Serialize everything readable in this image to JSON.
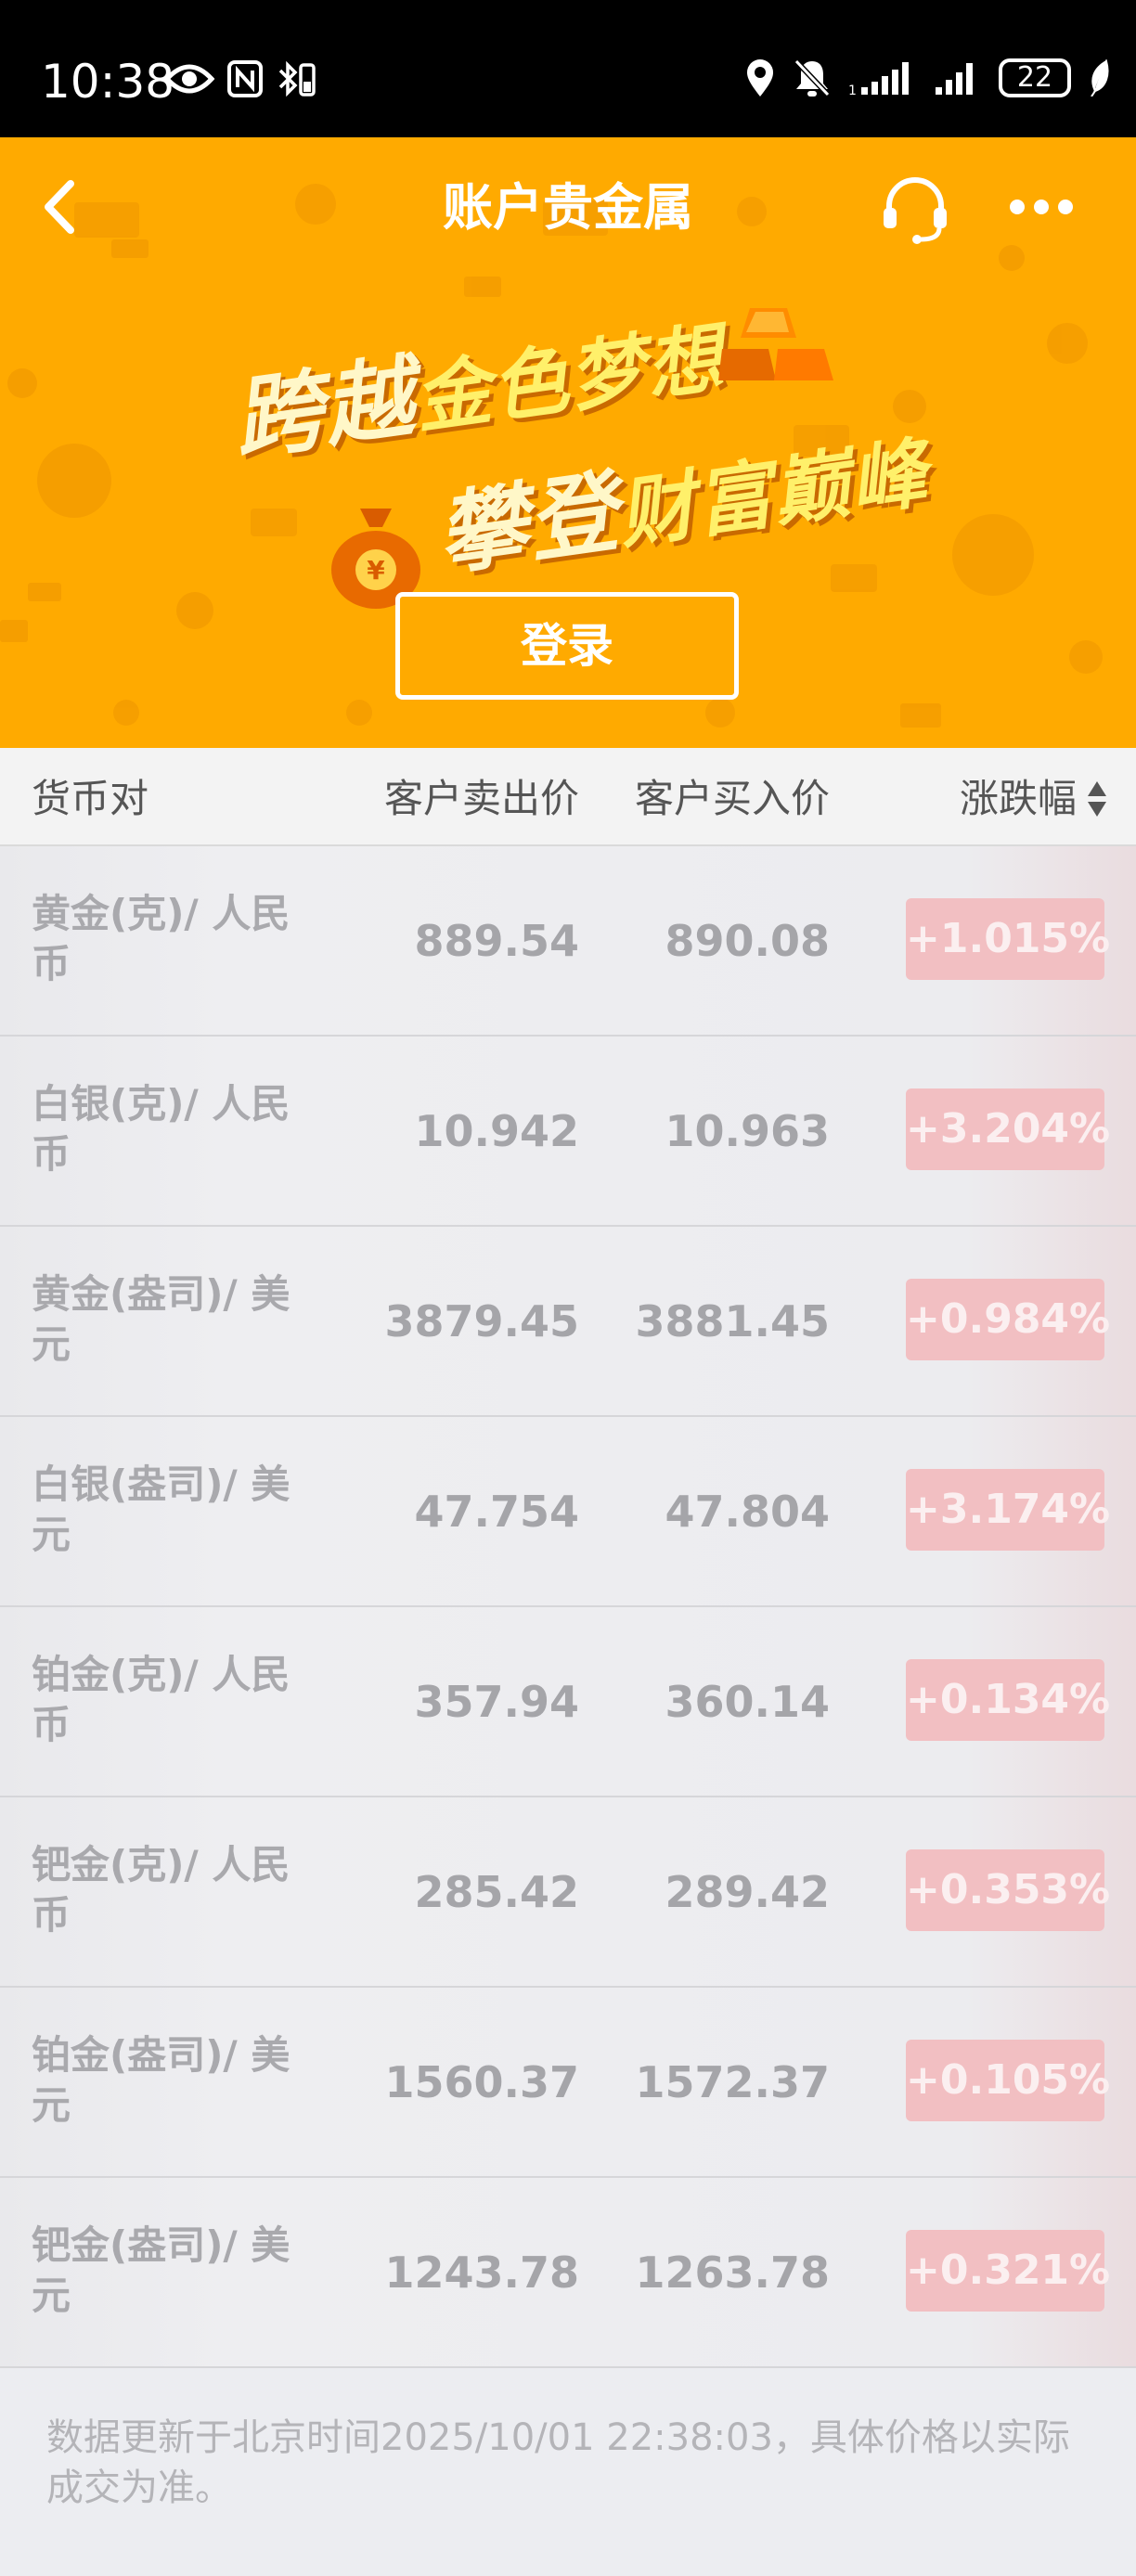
{
  "status_bar": {
    "time": "10:38",
    "battery": "22",
    "icons": [
      "eye-icon",
      "nfc-icon",
      "bluetooth-icon",
      "location-icon",
      "mute-icon",
      "signal-icon",
      "signal-icon",
      "battery-icon",
      "leaf-icon"
    ]
  },
  "header": {
    "title": "账户贵金属",
    "slogan_line1_a": "跨越",
    "slogan_line1_b": "金色梦想",
    "slogan_line2_a": "攀登",
    "slogan_line2_b": "财富巅峰",
    "login_label": "登录"
  },
  "table": {
    "columns": [
      "货币对",
      "客户卖出价",
      "客户买入价",
      "涨跌幅"
    ],
    "rows": [
      {
        "name": "黄金(克)/ 人民币",
        "sell": "889.54",
        "buy": "890.08",
        "change": "+1.015%"
      },
      {
        "name": "白银(克)/ 人民币",
        "sell": "10.942",
        "buy": "10.963",
        "change": "+3.204%"
      },
      {
        "name": "黄金(盎司)/ 美元",
        "sell": "3879.45",
        "buy": "3881.45",
        "change": "+0.984%"
      },
      {
        "name": "白银(盎司)/ 美元",
        "sell": "47.754",
        "buy": "47.804",
        "change": "+3.174%"
      },
      {
        "name": "铂金(克)/ 人民币",
        "sell": "357.94",
        "buy": "360.14",
        "change": "+0.134%"
      },
      {
        "name": "钯金(克)/ 人民币",
        "sell": "285.42",
        "buy": "289.42",
        "change": "+0.353%"
      },
      {
        "name": "铂金(盎司)/ 美元",
        "sell": "1560.37",
        "buy": "1572.37",
        "change": "+0.105%"
      },
      {
        "name": "钯金(盎司)/ 美元",
        "sell": "1243.78",
        "buy": "1263.78",
        "change": "+0.321%"
      }
    ]
  },
  "footer": {
    "note": "数据更新于北京时间2025/10/01 22:38:03，具体价格以实际成交为准。"
  },
  "colors": {
    "brand": "#ffaa00",
    "up": "#f2bfc2"
  }
}
